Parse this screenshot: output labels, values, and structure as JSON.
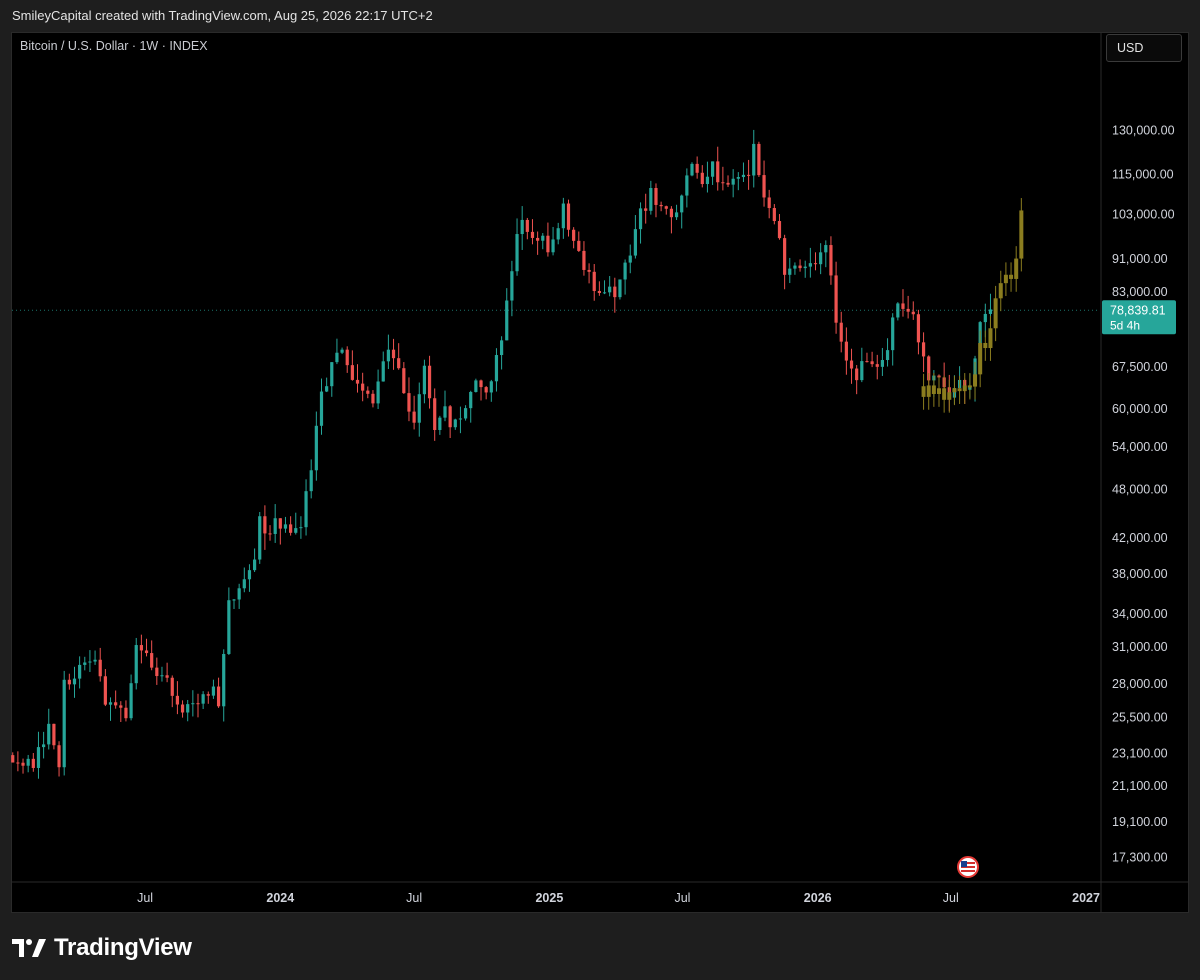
{
  "header": {
    "credit": "SmileyCapital created with TradingView.com, Aug 25, 2026 22:17 UTC+2"
  },
  "symbol": {
    "title": "Bitcoin / U.S. Dollar · 1W · INDEX"
  },
  "toolbar": {
    "currency_label": "USD"
  },
  "brand": {
    "name": "TradingView"
  },
  "colors": {
    "up": "#26a69a",
    "down": "#ef5350",
    "projection": "#8b7d1f",
    "price_tag": "#26a69a"
  },
  "chart_data": {
    "type": "candlestick",
    "title": "Bitcoin / U.S. Dollar · 1W · INDEX",
    "y_scale": "log",
    "ylim": [
      16000,
      140000
    ],
    "y_ticks": [
      {
        "value": 130000,
        "label": "130,000.00"
      },
      {
        "value": 115000,
        "label": "115,000.00"
      },
      {
        "value": 103000,
        "label": "103,000.00"
      },
      {
        "value": 91000,
        "label": "91,000.00"
      },
      {
        "value": 83000,
        "label": "83,000.00"
      },
      {
        "value": 67500,
        "label": "67,500.00"
      },
      {
        "value": 60000,
        "label": "60,000.00"
      },
      {
        "value": 54000,
        "label": "54,000.00"
      },
      {
        "value": 48000,
        "label": "48,000.00"
      },
      {
        "value": 42000,
        "label": "42,000.00"
      },
      {
        "value": 38000,
        "label": "38,000.00"
      },
      {
        "value": 34000,
        "label": "34,000.00"
      },
      {
        "value": 31000,
        "label": "31,000.00"
      },
      {
        "value": 28000,
        "label": "28,000.00"
      },
      {
        "value": 25500,
        "label": "25,500.00"
      },
      {
        "value": 23100,
        "label": "23,100.00"
      },
      {
        "value": 21100,
        "label": "21,100.00"
      },
      {
        "value": 19100,
        "label": "19,100.00"
      },
      {
        "value": 17300,
        "label": "17,300.00"
      }
    ],
    "x_ticks": [
      {
        "date": "2023-07-01",
        "label": "Jul",
        "bold": false
      },
      {
        "date": "2024-01-01",
        "label": "2024",
        "bold": true
      },
      {
        "date": "2024-07-01",
        "label": "Jul",
        "bold": false
      },
      {
        "date": "2025-01-01",
        "label": "2025",
        "bold": true
      },
      {
        "date": "2025-07-01",
        "label": "Jul",
        "bold": false
      },
      {
        "date": "2026-01-01",
        "label": "2026",
        "bold": true
      },
      {
        "date": "2026-07-01",
        "label": "Jul",
        "bold": false
      },
      {
        "date": "2027-01-01",
        "label": "2027",
        "bold": true
      }
    ],
    "xlim": [
      "2023-01-01",
      "2027-01-20"
    ],
    "current_price": {
      "value": 78839.81,
      "label": "78,839.81",
      "countdown": "5d 4h"
    },
    "actual_closes": [
      {
        "date": "2023-01-02",
        "close": 22500
      },
      {
        "date": "2023-01-16",
        "close": 21800
      },
      {
        "date": "2023-02-06",
        "close": 23000
      },
      {
        "date": "2023-02-20",
        "close": 24500
      },
      {
        "date": "2023-03-06",
        "close": 22200
      },
      {
        "date": "2023-03-13",
        "close": 27700
      },
      {
        "date": "2023-03-27",
        "close": 28300
      },
      {
        "date": "2023-04-10",
        "close": 30200
      },
      {
        "date": "2023-04-24",
        "close": 29300
      },
      {
        "date": "2023-05-08",
        "close": 27000
      },
      {
        "date": "2023-05-22",
        "close": 26800
      },
      {
        "date": "2023-06-05",
        "close": 25600
      },
      {
        "date": "2023-06-19",
        "close": 30500
      },
      {
        "date": "2023-07-03",
        "close": 30200
      },
      {
        "date": "2023-07-17",
        "close": 29300
      },
      {
        "date": "2023-07-31",
        "close": 29100
      },
      {
        "date": "2023-08-14",
        "close": 26100
      },
      {
        "date": "2023-08-28",
        "close": 25900
      },
      {
        "date": "2023-09-11",
        "close": 26600
      },
      {
        "date": "2023-09-25",
        "close": 27500
      },
      {
        "date": "2023-10-09",
        "close": 26800
      },
      {
        "date": "2023-10-16",
        "close": 30000
      },
      {
        "date": "2023-10-23",
        "close": 34500
      },
      {
        "date": "2023-11-06",
        "close": 37000
      },
      {
        "date": "2023-11-20",
        "close": 37500
      },
      {
        "date": "2023-12-04",
        "close": 43700
      },
      {
        "date": "2023-12-18",
        "close": 43000
      },
      {
        "date": "2024-01-01",
        "close": 44000
      },
      {
        "date": "2024-01-15",
        "close": 41600
      },
      {
        "date": "2024-01-29",
        "close": 42700
      },
      {
        "date": "2024-02-12",
        "close": 51500
      },
      {
        "date": "2024-02-26",
        "close": 62000
      },
      {
        "date": "2024-03-11",
        "close": 68000
      },
      {
        "date": "2024-03-25",
        "close": 69500
      },
      {
        "date": "2024-04-08",
        "close": 64000
      },
      {
        "date": "2024-04-22",
        "close": 63000
      },
      {
        "date": "2024-05-06",
        "close": 61500
      },
      {
        "date": "2024-05-20",
        "close": 68500
      },
      {
        "date": "2024-06-03",
        "close": 69500
      },
      {
        "date": "2024-06-17",
        "close": 63000
      },
      {
        "date": "2024-07-01",
        "close": 57000
      },
      {
        "date": "2024-07-15",
        "close": 68000
      },
      {
        "date": "2024-07-29",
        "close": 58000
      },
      {
        "date": "2024-08-12",
        "close": 59000
      },
      {
        "date": "2024-08-26",
        "close": 57000
      },
      {
        "date": "2024-09-09",
        "close": 60000
      },
      {
        "date": "2024-09-23",
        "close": 65500
      },
      {
        "date": "2024-10-07",
        "close": 63000
      },
      {
        "date": "2024-10-21",
        "close": 69000
      },
      {
        "date": "2024-11-04",
        "close": 80000
      },
      {
        "date": "2024-11-18",
        "close": 98000
      },
      {
        "date": "2024-12-02",
        "close": 100500
      },
      {
        "date": "2024-12-16",
        "close": 95000
      },
      {
        "date": "2025-01-06",
        "close": 94000
      },
      {
        "date": "2025-01-20",
        "close": 104500
      },
      {
        "date": "2025-02-03",
        "close": 97500
      },
      {
        "date": "2025-02-24",
        "close": 86000
      },
      {
        "date": "2025-03-10",
        "close": 82500
      },
      {
        "date": "2025-03-24",
        "close": 83000
      },
      {
        "date": "2025-04-07",
        "close": 84500
      },
      {
        "date": "2025-04-21",
        "close": 94000
      },
      {
        "date": "2025-05-05",
        "close": 104000
      },
      {
        "date": "2025-05-19",
        "close": 109000
      },
      {
        "date": "2025-06-02",
        "close": 105500
      },
      {
        "date": "2025-06-16",
        "close": 101500
      },
      {
        "date": "2025-06-30",
        "close": 109000
      },
      {
        "date": "2025-07-14",
        "close": 119000
      },
      {
        "date": "2025-07-28",
        "close": 114000
      },
      {
        "date": "2025-08-11",
        "close": 117500
      },
      {
        "date": "2025-08-25",
        "close": 110000
      },
      {
        "date": "2025-09-08",
        "close": 115500
      },
      {
        "date": "2025-09-22",
        "close": 112000
      },
      {
        "date": "2025-10-06",
        "close": 123000
      },
      {
        "date": "2025-10-20",
        "close": 110000
      },
      {
        "date": "2025-11-03",
        "close": 102000
      },
      {
        "date": "2025-11-17",
        "close": 87000
      },
      {
        "date": "2025-12-01",
        "close": 90000
      },
      {
        "date": "2025-12-15",
        "close": 88000
      },
      {
        "date": "2025-12-29",
        "close": 90500
      },
      {
        "date": "2026-01-12",
        "close": 93500
      },
      {
        "date": "2026-01-26",
        "close": 77000
      },
      {
        "date": "2026-02-09",
        "close": 70000
      },
      {
        "date": "2026-02-23",
        "close": 66000
      },
      {
        "date": "2026-03-09",
        "close": 70000
      },
      {
        "date": "2026-03-23",
        "close": 67000
      },
      {
        "date": "2026-04-06",
        "close": 72000
      },
      {
        "date": "2026-04-20",
        "close": 79000
      },
      {
        "date": "2026-05-04",
        "close": 80000
      },
      {
        "date": "2026-05-18",
        "close": 73000
      },
      {
        "date": "2026-06-01",
        "close": 66000
      },
      {
        "date": "2026-06-15",
        "close": 64500
      },
      {
        "date": "2026-06-29",
        "close": 62000
      },
      {
        "date": "2026-07-13",
        "close": 63500
      },
      {
        "date": "2026-07-27",
        "close": 65000
      },
      {
        "date": "2026-08-10",
        "close": 75000
      },
      {
        "date": "2026-08-24",
        "close": 78840
      }
    ],
    "projection_closes": [
      {
        "date": "2026-05-25",
        "close": 62000
      },
      {
        "date": "2026-06-01",
        "close": 64000
      },
      {
        "date": "2026-06-08",
        "close": 62500
      },
      {
        "date": "2026-06-15",
        "close": 63500
      },
      {
        "date": "2026-06-22",
        "close": 61500
      },
      {
        "date": "2026-06-29",
        "close": 62800
      },
      {
        "date": "2026-07-06",
        "close": 63500
      },
      {
        "date": "2026-07-13",
        "close": 63000
      },
      {
        "date": "2026-07-20",
        "close": 64000
      },
      {
        "date": "2026-07-27",
        "close": 63800
      },
      {
        "date": "2026-08-03",
        "close": 66000
      },
      {
        "date": "2026-08-10",
        "close": 72000
      },
      {
        "date": "2026-08-17",
        "close": 71000
      },
      {
        "date": "2026-08-24",
        "close": 75000
      },
      {
        "date": "2026-08-31",
        "close": 81500
      },
      {
        "date": "2026-09-07",
        "close": 85000
      },
      {
        "date": "2026-09-14",
        "close": 87000
      },
      {
        "date": "2026-09-21",
        "close": 86000
      },
      {
        "date": "2026-09-28",
        "close": 91000
      },
      {
        "date": "2026-10-05",
        "close": 104000
      }
    ]
  }
}
